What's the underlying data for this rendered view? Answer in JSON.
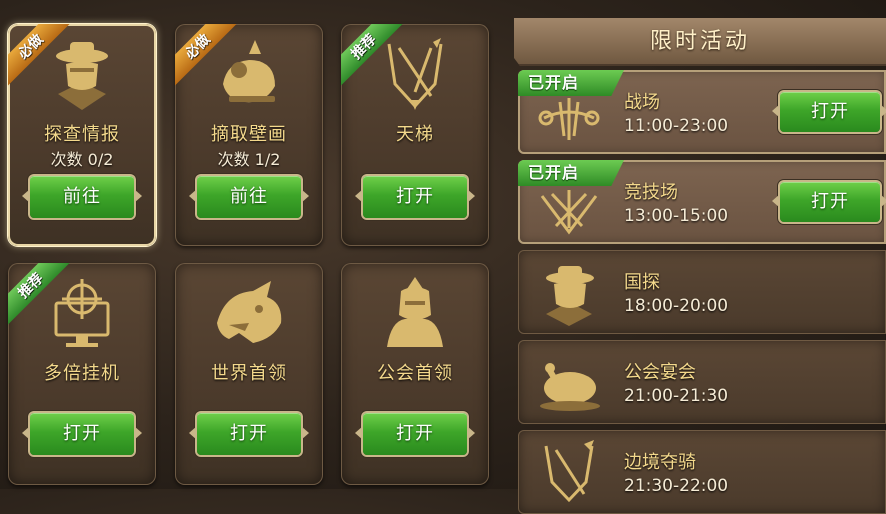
{
  "cards": [
    {
      "title": "探查情报",
      "count": "次数 0/2",
      "button": "前往",
      "badge": "必做",
      "badge_color": "orange",
      "icon": "spy-detective-icon"
    },
    {
      "title": "摘取壁画",
      "count": "次数 1/2",
      "button": "前往",
      "badge": "必做",
      "badge_color": "orange",
      "icon": "mural-thief-icon"
    },
    {
      "title": "天梯",
      "count": "",
      "button": "打开",
      "badge": "推荐",
      "badge_color": "green",
      "icon": "ladder-shield-icon"
    },
    {
      "title": "多倍挂机",
      "count": "",
      "button": "打开",
      "badge": "推荐",
      "badge_color": "green",
      "icon": "crosshair-monitor-icon"
    },
    {
      "title": "世界首领",
      "count": "",
      "button": "打开",
      "badge": "",
      "badge_color": "",
      "icon": "dragon-head-icon"
    },
    {
      "title": "公会首领",
      "count": "",
      "button": "打开",
      "badge": "",
      "badge_color": "",
      "icon": "armored-knight-icon"
    }
  ],
  "panel": {
    "title": "限时活动"
  },
  "events": [
    {
      "name": "战场",
      "time": "11:00-23:00",
      "status": "已开启",
      "button": "打开",
      "icon": "battlefield-swords-icon"
    },
    {
      "name": "竞技场",
      "time": "13:00-15:00",
      "status": "已开启",
      "button": "打开",
      "icon": "arena-crossed-weapons-icon"
    },
    {
      "name": "国探",
      "time": "18:00-20:00",
      "status": "",
      "button": "",
      "icon": "spy-detective-icon"
    },
    {
      "name": "公会宴会",
      "time": "21:00-21:30",
      "status": "",
      "button": "",
      "icon": "roast-chicken-icon"
    },
    {
      "name": "边境夺骑",
      "time": "21:30-22:00",
      "status": "",
      "button": "",
      "icon": "border-spear-icon"
    }
  ],
  "colors": {
    "accent_gold": "#f4d98c",
    "button_green": "#3ea629",
    "badge_orange": "#d4902a",
    "badge_green": "#3f9c34"
  }
}
